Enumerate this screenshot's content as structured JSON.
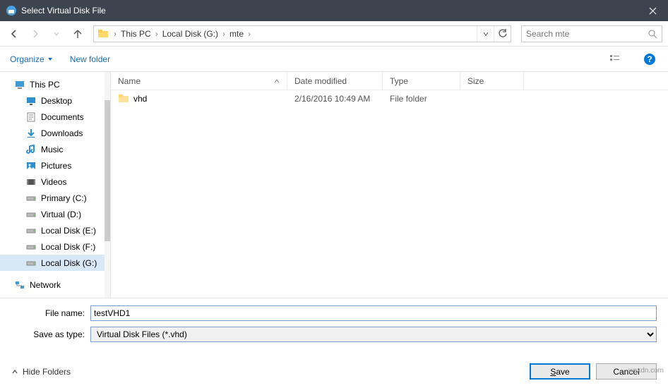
{
  "window": {
    "title": "Select Virtual Disk File"
  },
  "nav": {
    "breadcrumb": [
      "This PC",
      "Local Disk (G:)",
      "mte"
    ],
    "search_placeholder": "Search mte"
  },
  "toolbar": {
    "organize": "Organize",
    "new_folder": "New folder"
  },
  "tree": {
    "items": [
      {
        "label": "This PC",
        "icon": "pc",
        "indent": false,
        "sel": false
      },
      {
        "label": "Desktop",
        "icon": "desktop",
        "indent": true,
        "sel": false
      },
      {
        "label": "Documents",
        "icon": "docs",
        "indent": true,
        "sel": false
      },
      {
        "label": "Downloads",
        "icon": "down",
        "indent": true,
        "sel": false
      },
      {
        "label": "Music",
        "icon": "music",
        "indent": true,
        "sel": false
      },
      {
        "label": "Pictures",
        "icon": "pics",
        "indent": true,
        "sel": false
      },
      {
        "label": "Videos",
        "icon": "video",
        "indent": true,
        "sel": false
      },
      {
        "label": "Primary (C:)",
        "icon": "drive",
        "indent": true,
        "sel": false
      },
      {
        "label": "Virtual (D:)",
        "icon": "drive",
        "indent": true,
        "sel": false
      },
      {
        "label": "Local Disk (E:)",
        "icon": "drive",
        "indent": true,
        "sel": false
      },
      {
        "label": "Local Disk (F:)",
        "icon": "drive",
        "indent": true,
        "sel": false
      },
      {
        "label": "Local Disk (G:)",
        "icon": "drive",
        "indent": true,
        "sel": true
      },
      {
        "label": "Network",
        "icon": "net",
        "indent": false,
        "sel": false
      }
    ]
  },
  "filelist": {
    "headers": {
      "name": "Name",
      "date": "Date modified",
      "type": "Type",
      "size": "Size"
    },
    "rows": [
      {
        "name": "vhd",
        "date": "2/16/2016 10:49 AM",
        "type": "File folder",
        "size": ""
      }
    ]
  },
  "fields": {
    "filename_label": "File name:",
    "filename_value": "testVHD1",
    "saveastype_label": "Save as type:",
    "saveastype_value": "Virtual Disk Files (*.vhd)"
  },
  "actions": {
    "hide_folders": "Hide Folders",
    "save": "Save",
    "cancel": "Cancel"
  },
  "watermark": "wsxdn.com"
}
